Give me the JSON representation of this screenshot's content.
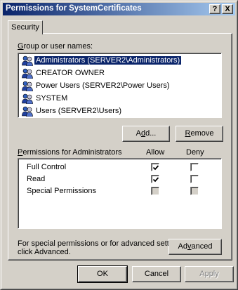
{
  "window": {
    "title": "Permissions for SystemCertificates",
    "help_glyph": "?",
    "close_glyph": "X"
  },
  "tabs": [
    {
      "label": "Security",
      "selected": true
    }
  ],
  "group_label": {
    "pre": "",
    "key": "G",
    "post": "roup or user names:"
  },
  "users": [
    {
      "name": "Administrators (SERVER2\\Administrators)",
      "selected": true,
      "icon": "group-icon"
    },
    {
      "name": "CREATOR OWNER",
      "selected": false,
      "icon": "group-icon"
    },
    {
      "name": "Power Users (SERVER2\\Power Users)",
      "selected": false,
      "icon": "group-icon"
    },
    {
      "name": "SYSTEM",
      "selected": false,
      "icon": "group-icon"
    },
    {
      "name": "Users (SERVER2\\Users)",
      "selected": false,
      "icon": "group-icon"
    }
  ],
  "add_button": {
    "pre": "A",
    "key": "d",
    "post": "d..."
  },
  "remove_button": {
    "pre": "",
    "key": "R",
    "post": "emove"
  },
  "permissions_label": {
    "pre": "",
    "key": "P",
    "post": "ermissions for Administrators"
  },
  "allow_header": "Allow",
  "deny_header": "Deny",
  "permissions": [
    {
      "name": "Full Control",
      "allow": true,
      "deny": false,
      "allow_disabled": false,
      "deny_disabled": false
    },
    {
      "name": "Read",
      "allow": true,
      "deny": false,
      "allow_disabled": false,
      "deny_disabled": false
    },
    {
      "name": "Special Permissions",
      "allow": false,
      "deny": false,
      "allow_disabled": true,
      "deny_disabled": true
    }
  ],
  "advanced_note_line1": "For special permissions or for advanced settings,",
  "advanced_note_line2": "click Advanced.",
  "advanced_button": {
    "pre": "Ad",
    "key": "v",
    "post": "anced"
  },
  "footer": {
    "ok": "OK",
    "cancel": "Cancel",
    "apply": "Apply"
  },
  "colors": {
    "titlebar_start": "#0a246a",
    "titlebar_end": "#a6caf0",
    "face": "#d4d0c8",
    "selection": "#0a246a"
  }
}
